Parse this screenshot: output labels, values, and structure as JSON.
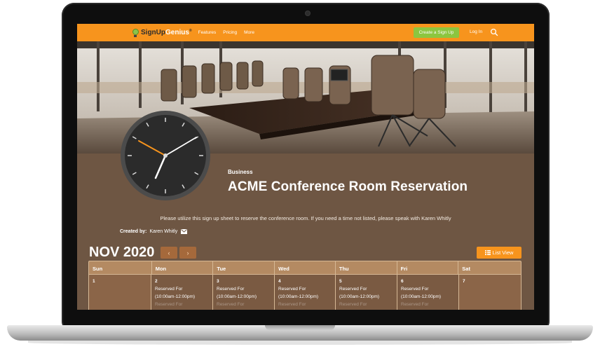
{
  "navbar": {
    "logo_text_a": "SignUp",
    "logo_text_b": "Genius",
    "logo_sup": "®",
    "links": [
      "Features",
      "Pricing",
      "More"
    ],
    "create_button": "Create a Sign Up",
    "login": "Log In",
    "search_icon": "search-icon"
  },
  "header": {
    "category": "Business",
    "title": "ACME Conference Room Reservation",
    "description": "Please utilize this sign up sheet to reserve the conference room.  If you need a time not listed, please speak with Karen Whitly",
    "created_by_label": "Created by:",
    "created_by_name": "Karen Whitly"
  },
  "calendar": {
    "month": "NOV 2020",
    "prev_label": "‹",
    "next_label": "›",
    "list_view_label": "List View",
    "weekdays": [
      "Sun",
      "Mon",
      "Tue",
      "Wed",
      "Thu",
      "Fri",
      "Sat"
    ],
    "days": [
      {
        "date": "1",
        "slot": "",
        "time": "",
        "extra": ""
      },
      {
        "date": "2",
        "slot": "Reserved For",
        "time": "(10:00am-12:00pm)",
        "extra": "Reserved For"
      },
      {
        "date": "3",
        "slot": "Reserved For",
        "time": "(10:00am-12:00pm)",
        "extra": "Reserved For"
      },
      {
        "date": "4",
        "slot": "Reserved For",
        "time": "(10:00am-12:00pm)",
        "extra": "Reserved For"
      },
      {
        "date": "5",
        "slot": "Reserved For",
        "time": "(10:00am-12:00pm)",
        "extra": "Reserved For"
      },
      {
        "date": "6",
        "slot": "Reserved For",
        "time": "(10:00am-12:00pm)",
        "extra": "Reserved For"
      },
      {
        "date": "7",
        "slot": "",
        "time": "",
        "extra": ""
      }
    ]
  },
  "colors": {
    "brand_orange": "#f7941d",
    "create_green": "#8cc63f",
    "page_brown": "#6e5643"
  }
}
